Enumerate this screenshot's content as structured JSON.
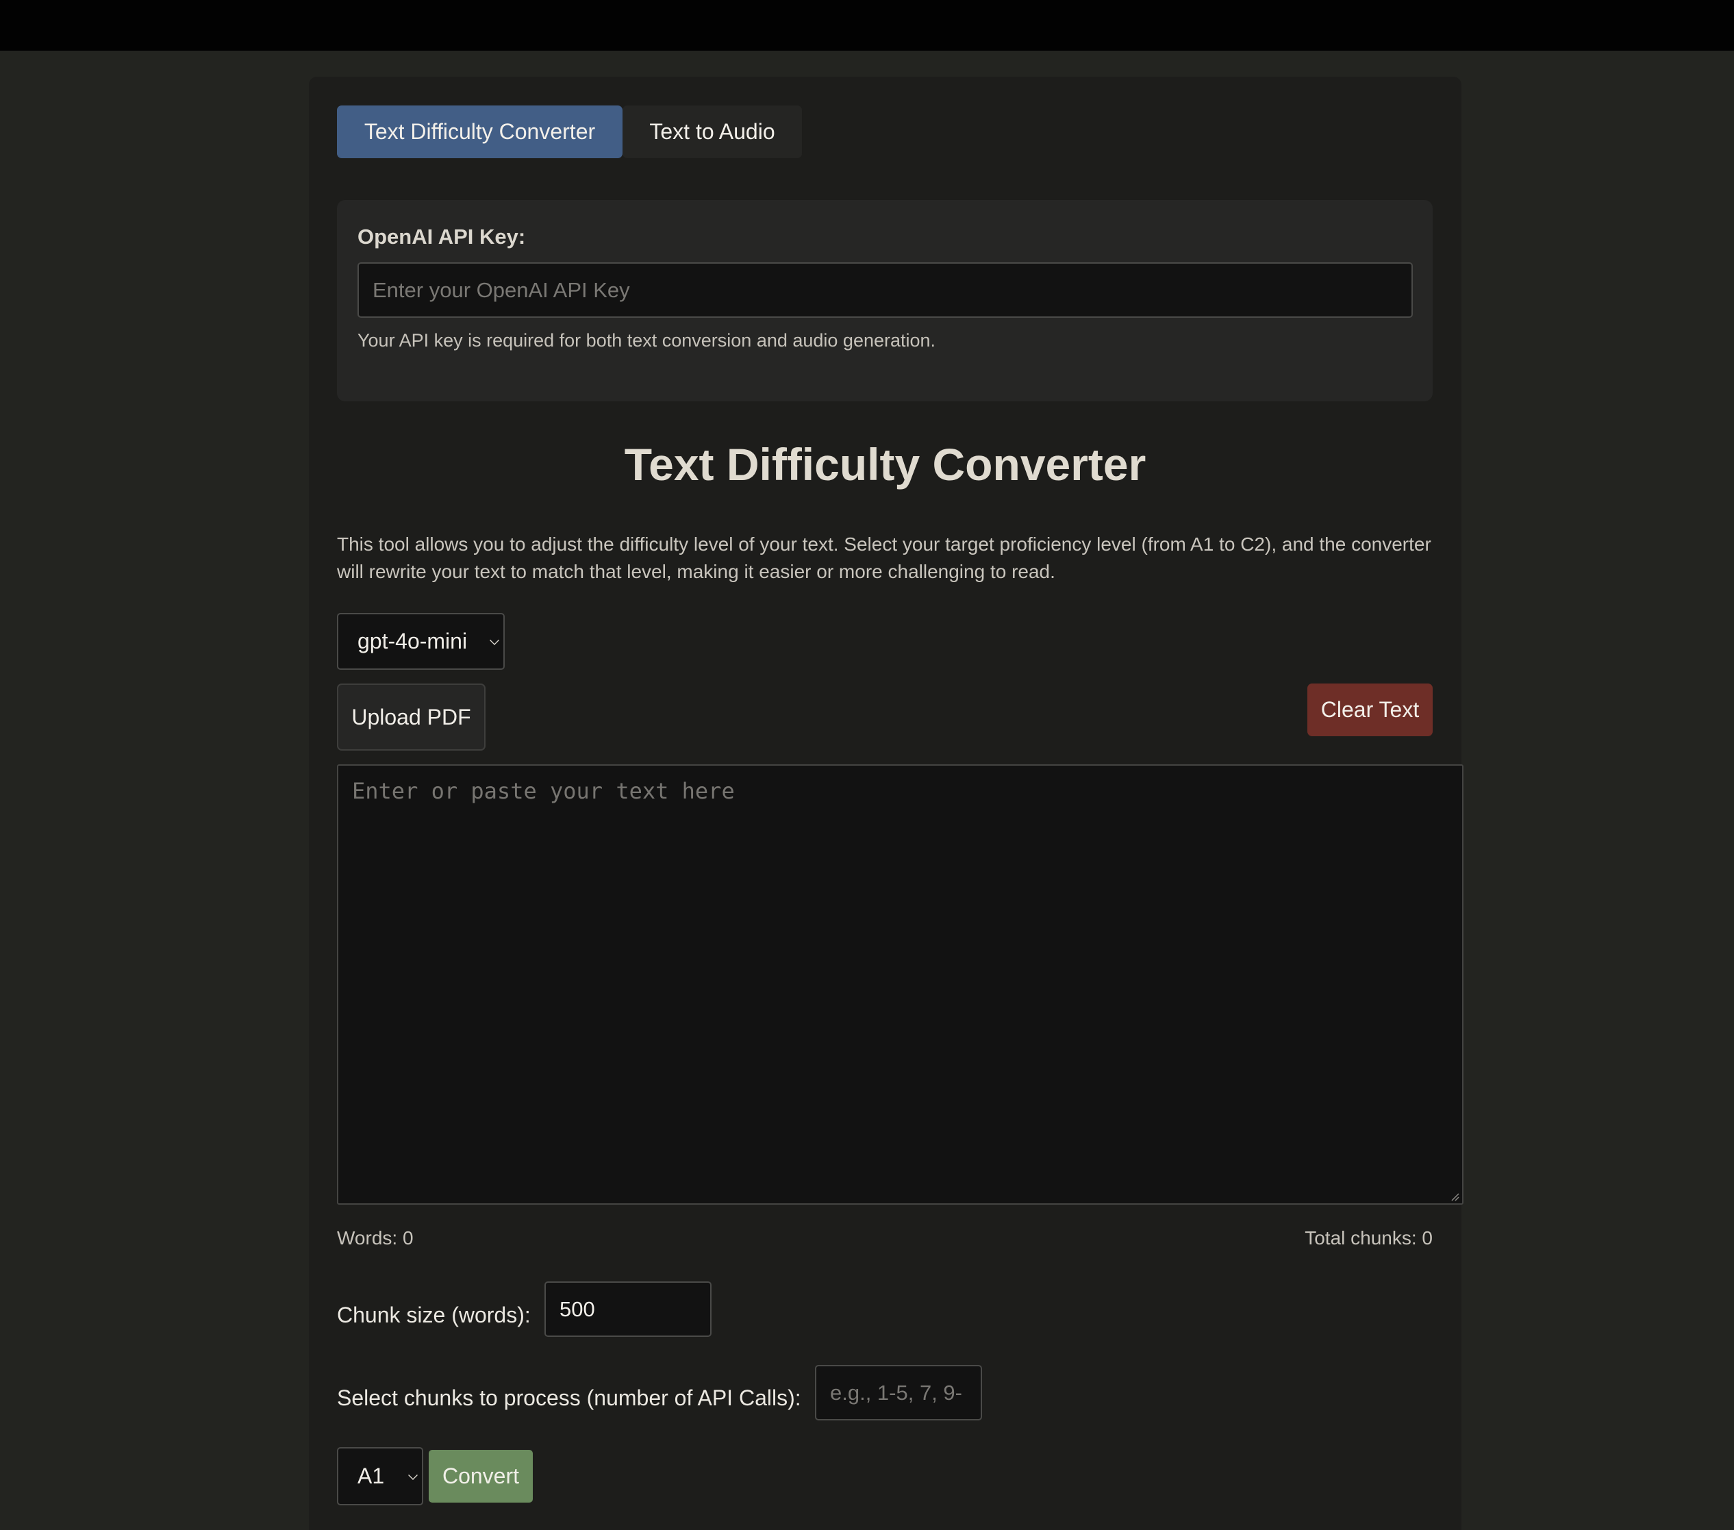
{
  "tabs": [
    {
      "label": "Text Difficulty Converter",
      "active": true
    },
    {
      "label": "Text to Audio",
      "active": false
    }
  ],
  "api_key": {
    "label": "OpenAI API Key:",
    "placeholder": "Enter your OpenAI API Key",
    "value": "",
    "help": "Your API key is required for both text conversion and audio generation."
  },
  "main": {
    "title": "Text Difficulty Converter",
    "description": "This tool allows you to adjust the difficulty level of your text. Select your target proficiency level (from A1 to C2), and the converter will rewrite your text to match that level, making it easier or more challenging to read."
  },
  "model_select": {
    "selected": "gpt-4o-mini",
    "icon": "chevron-down-icon"
  },
  "buttons": {
    "upload_pdf": "Upload PDF",
    "clear_text": "Clear Text",
    "convert": "Convert"
  },
  "text_input": {
    "placeholder": "Enter or paste your text here",
    "value": ""
  },
  "stats": {
    "words": "Words: 0",
    "total_chunks": "Total chunks: 0"
  },
  "chunk_size": {
    "label": "Chunk size (words):",
    "value": "500"
  },
  "chunk_selection": {
    "label": "Select chunks to process (number of API Calls):",
    "placeholder": "e.g., 1-5, 7, 9-",
    "value": ""
  },
  "level_select": {
    "selected": "A1",
    "icon": "chevron-down-icon"
  },
  "colors": {
    "background": "#232420",
    "panel": "#1d1d1b",
    "active_tab": "#425e86",
    "clear_button": "#6e2e27",
    "convert_button": "#6a8b5d",
    "input_background": "#121212"
  }
}
